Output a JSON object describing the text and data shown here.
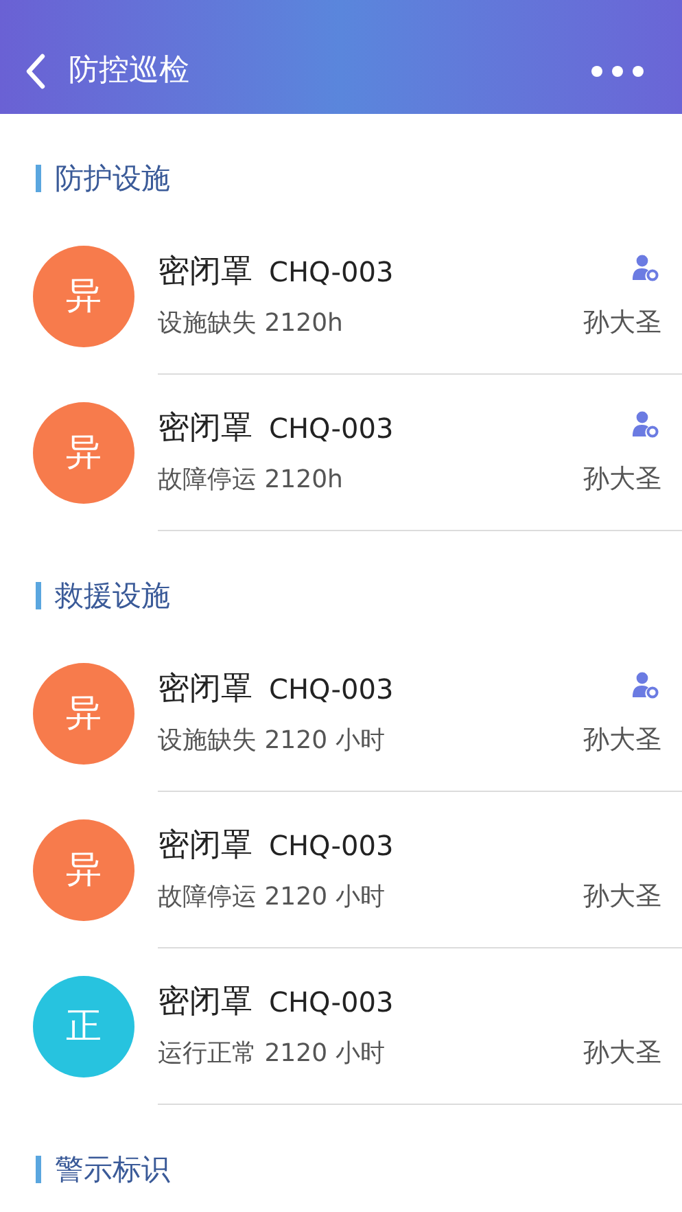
{
  "header": {
    "title": "防控巡检"
  },
  "sections": [
    {
      "title": "防护设施",
      "items": [
        {
          "badge": "异",
          "color": "#f77b4c",
          "name": "密闭罩",
          "code": "CHQ-003",
          "status": "设施缺失 2120h",
          "person": "孙大圣",
          "has_person_icon": true
        },
        {
          "badge": "异",
          "color": "#f77b4c",
          "name": "密闭罩",
          "code": "CHQ-003",
          "status": "故障停运 2120h",
          "person": "孙大圣",
          "has_person_icon": true
        }
      ]
    },
    {
      "title": "救援设施",
      "items": [
        {
          "badge": "异",
          "color": "#f77b4c",
          "name": "密闭罩",
          "code": "CHQ-003",
          "status": "设施缺失 2120 小时",
          "person": "孙大圣",
          "has_person_icon": true
        },
        {
          "badge": "异",
          "color": "#f77b4c",
          "name": "密闭罩",
          "code": "CHQ-003",
          "status": "故障停运 2120 小时",
          "person": "孙大圣",
          "has_person_icon": false
        },
        {
          "badge": "正",
          "color": "#27c3df",
          "name": "密闭罩",
          "code": "CHQ-003",
          "status": "运行正常 2120 小时",
          "person": "孙大圣",
          "has_person_icon": false
        }
      ]
    },
    {
      "title": "警示标识"
    }
  ]
}
